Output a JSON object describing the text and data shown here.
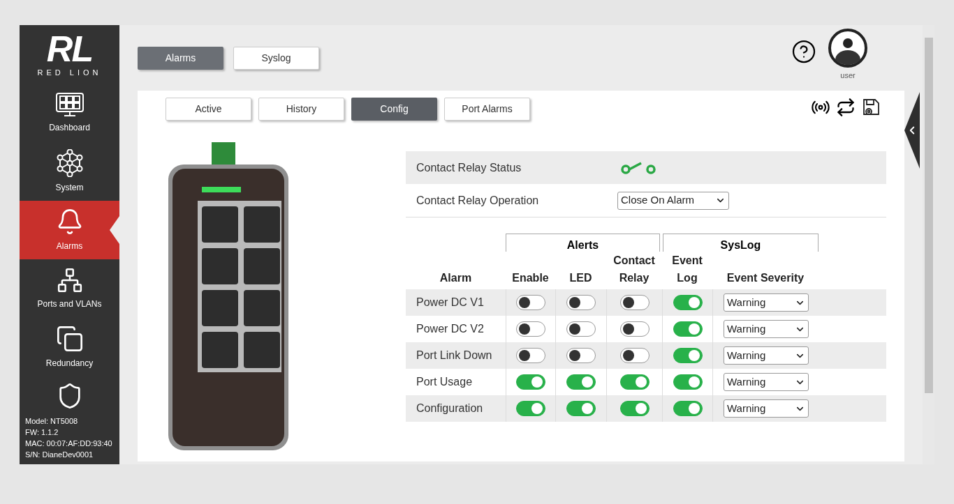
{
  "sidebar": {
    "logo": {
      "mark": "RL",
      "wordmark": "RED LION"
    },
    "items": [
      {
        "label": "Dashboard",
        "selected": false
      },
      {
        "label": "System",
        "selected": false
      },
      {
        "label": "Alarms",
        "selected": true
      },
      {
        "label": "Ports and VLANs",
        "selected": false
      },
      {
        "label": "Redundancy",
        "selected": false
      }
    ],
    "device_info": [
      "Model: NT5008",
      "FW: 1.1.2",
      "MAC: 00:07:AF:DD:93:40",
      "S/N: DianeDev0001"
    ]
  },
  "top_tabs": [
    {
      "label": "Alarms",
      "selected": true
    },
    {
      "label": "Syslog",
      "selected": false
    }
  ],
  "user": {
    "name": "user"
  },
  "sub_tabs": [
    {
      "label": "Active",
      "selected": false
    },
    {
      "label": "History",
      "selected": false
    },
    {
      "label": "Config",
      "selected": true
    },
    {
      "label": "Port Alarms",
      "selected": false
    }
  ],
  "relay": {
    "status_label": "Contact Relay Status",
    "operation_label": "Contact Relay Operation",
    "operation_value": "Close On Alarm"
  },
  "alarm_table": {
    "groups": [
      "Alerts",
      "SysLog"
    ],
    "columns": [
      "Alarm",
      "Enable",
      "LED",
      "Contact Relay",
      "Event Log",
      "Event Severity"
    ],
    "rows": [
      {
        "alarm": "Power DC V1",
        "enable": false,
        "led": false,
        "relay": false,
        "event_log": true,
        "severity": "Warning"
      },
      {
        "alarm": "Power DC V2",
        "enable": false,
        "led": false,
        "relay": false,
        "event_log": true,
        "severity": "Warning"
      },
      {
        "alarm": "Port Link Down",
        "enable": false,
        "led": false,
        "relay": false,
        "event_log": true,
        "severity": "Warning"
      },
      {
        "alarm": "Port Usage",
        "enable": true,
        "led": true,
        "relay": true,
        "event_log": true,
        "severity": "Warning"
      },
      {
        "alarm": "Configuration",
        "enable": true,
        "led": true,
        "relay": true,
        "event_log": true,
        "severity": "Warning"
      }
    ]
  }
}
